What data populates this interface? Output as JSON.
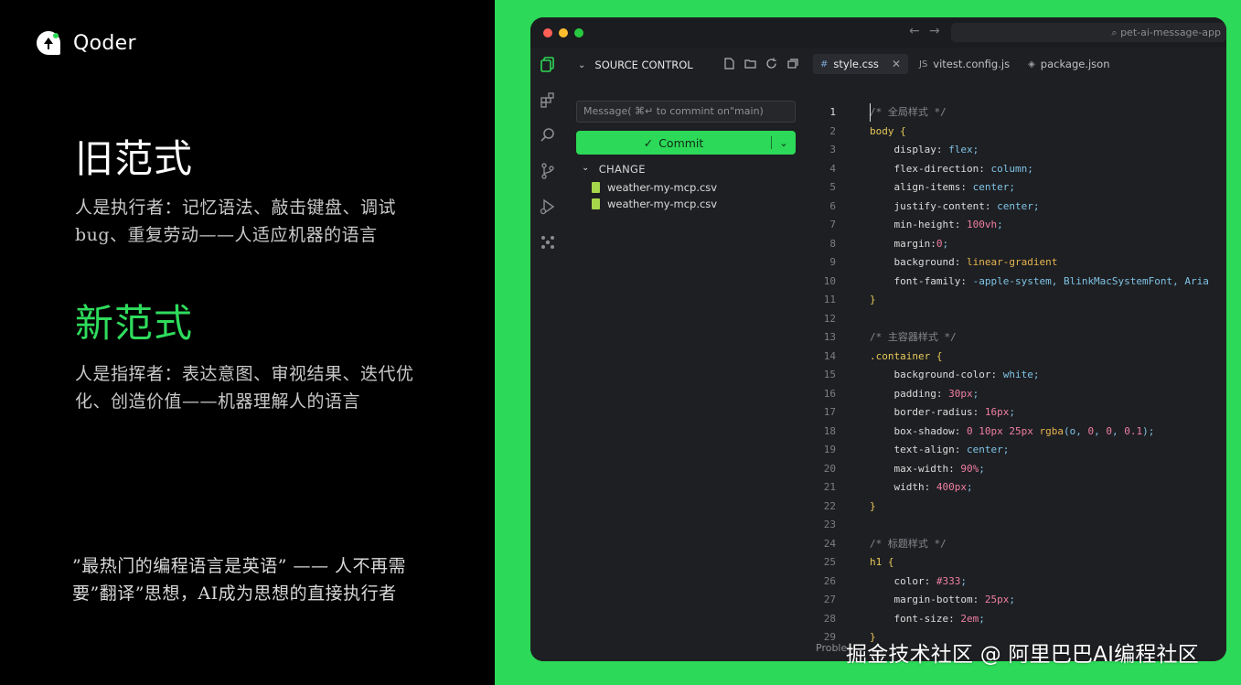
{
  "brand": {
    "name": "Qoder"
  },
  "slide": {
    "old_title": "旧范式",
    "old_desc": "人是执行者：记忆语法、敲击键盘、调试bug、重复劳动——人适应机器的语言",
    "new_title": "新范式",
    "new_desc": "人是指挥者：表达意图、审视结果、迭代优化、创造价值——机器理解人的语言",
    "quote": "”最热门的编程语言是英语” —— 人不再需要”翻译”思想，AI成为思想的直接执行者"
  },
  "colors": {
    "accent_green": "#2cd958",
    "new_title": "#2fdc5c",
    "ide_bg": "#1e1f22"
  },
  "ide": {
    "search_text": "⌕ pet-ai-message-app",
    "source_control": {
      "title": "SOURCE CONTROL",
      "message_placeholder": "Message( ⌘↵ to commint on\"main)",
      "commit_label": "Commit",
      "changes_title": "CHANGE",
      "files": [
        "weather-my-mcp.csv",
        "weather-my-mcp.csv"
      ]
    },
    "tabs": [
      {
        "icon": "#",
        "label": "style.css",
        "active": true
      },
      {
        "icon": "JS",
        "label": "vitest.config.js",
        "active": false
      },
      {
        "icon": "◈",
        "label": "package.json",
        "active": false
      }
    ],
    "status_text": "Proble",
    "code_lines": [
      {
        "n": "1",
        "t": "/* 全局样式 */"
      },
      {
        "n": "2",
        "t": "body {"
      },
      {
        "n": "3",
        "t": "    display: flex;"
      },
      {
        "n": "4",
        "t": "    flex-direction: column;"
      },
      {
        "n": "5",
        "t": "    align-items: center;"
      },
      {
        "n": "6",
        "t": "    justify-content: center;"
      },
      {
        "n": "7",
        "t": "    min-height: 100vh;"
      },
      {
        "n": "8",
        "t": "    margin:0;"
      },
      {
        "n": "9",
        "t": "    background: linear-gradient"
      },
      {
        "n": "10",
        "t": "    font-family: -apple-system, BlinkMacSystemFont, Aria"
      },
      {
        "n": "11",
        "t": "}"
      },
      {
        "n": "12",
        "t": ""
      },
      {
        "n": "13",
        "t": "/* 主容器样式 */"
      },
      {
        "n": "14",
        "t": ".container {"
      },
      {
        "n": "15",
        "t": "    background-color: white;"
      },
      {
        "n": "16",
        "t": "    padding: 30px;"
      },
      {
        "n": "17",
        "t": "    border-radius: 16px;"
      },
      {
        "n": "18",
        "t": "    box-shadow: 0 10px 25px rgba(o, 0, 0, 0.1);"
      },
      {
        "n": "19",
        "t": "    text-align: center;"
      },
      {
        "n": "20",
        "t": "    max-width: 90%;"
      },
      {
        "n": "21",
        "t": "    width: 400px;"
      },
      {
        "n": "22",
        "t": "}"
      },
      {
        "n": "23",
        "t": ""
      },
      {
        "n": "24",
        "t": "/* 标题样式 */"
      },
      {
        "n": "25",
        "t": "h1 {"
      },
      {
        "n": "26",
        "t": "    color: #333;"
      },
      {
        "n": "27",
        "t": "    margin-bottom: 25px;"
      },
      {
        "n": "28",
        "t": "    font-size: 2em;"
      },
      {
        "n": "29",
        "t": "}"
      }
    ]
  },
  "watermark": "掘金技术社区 @ 阿里巴巴AI编程社区"
}
